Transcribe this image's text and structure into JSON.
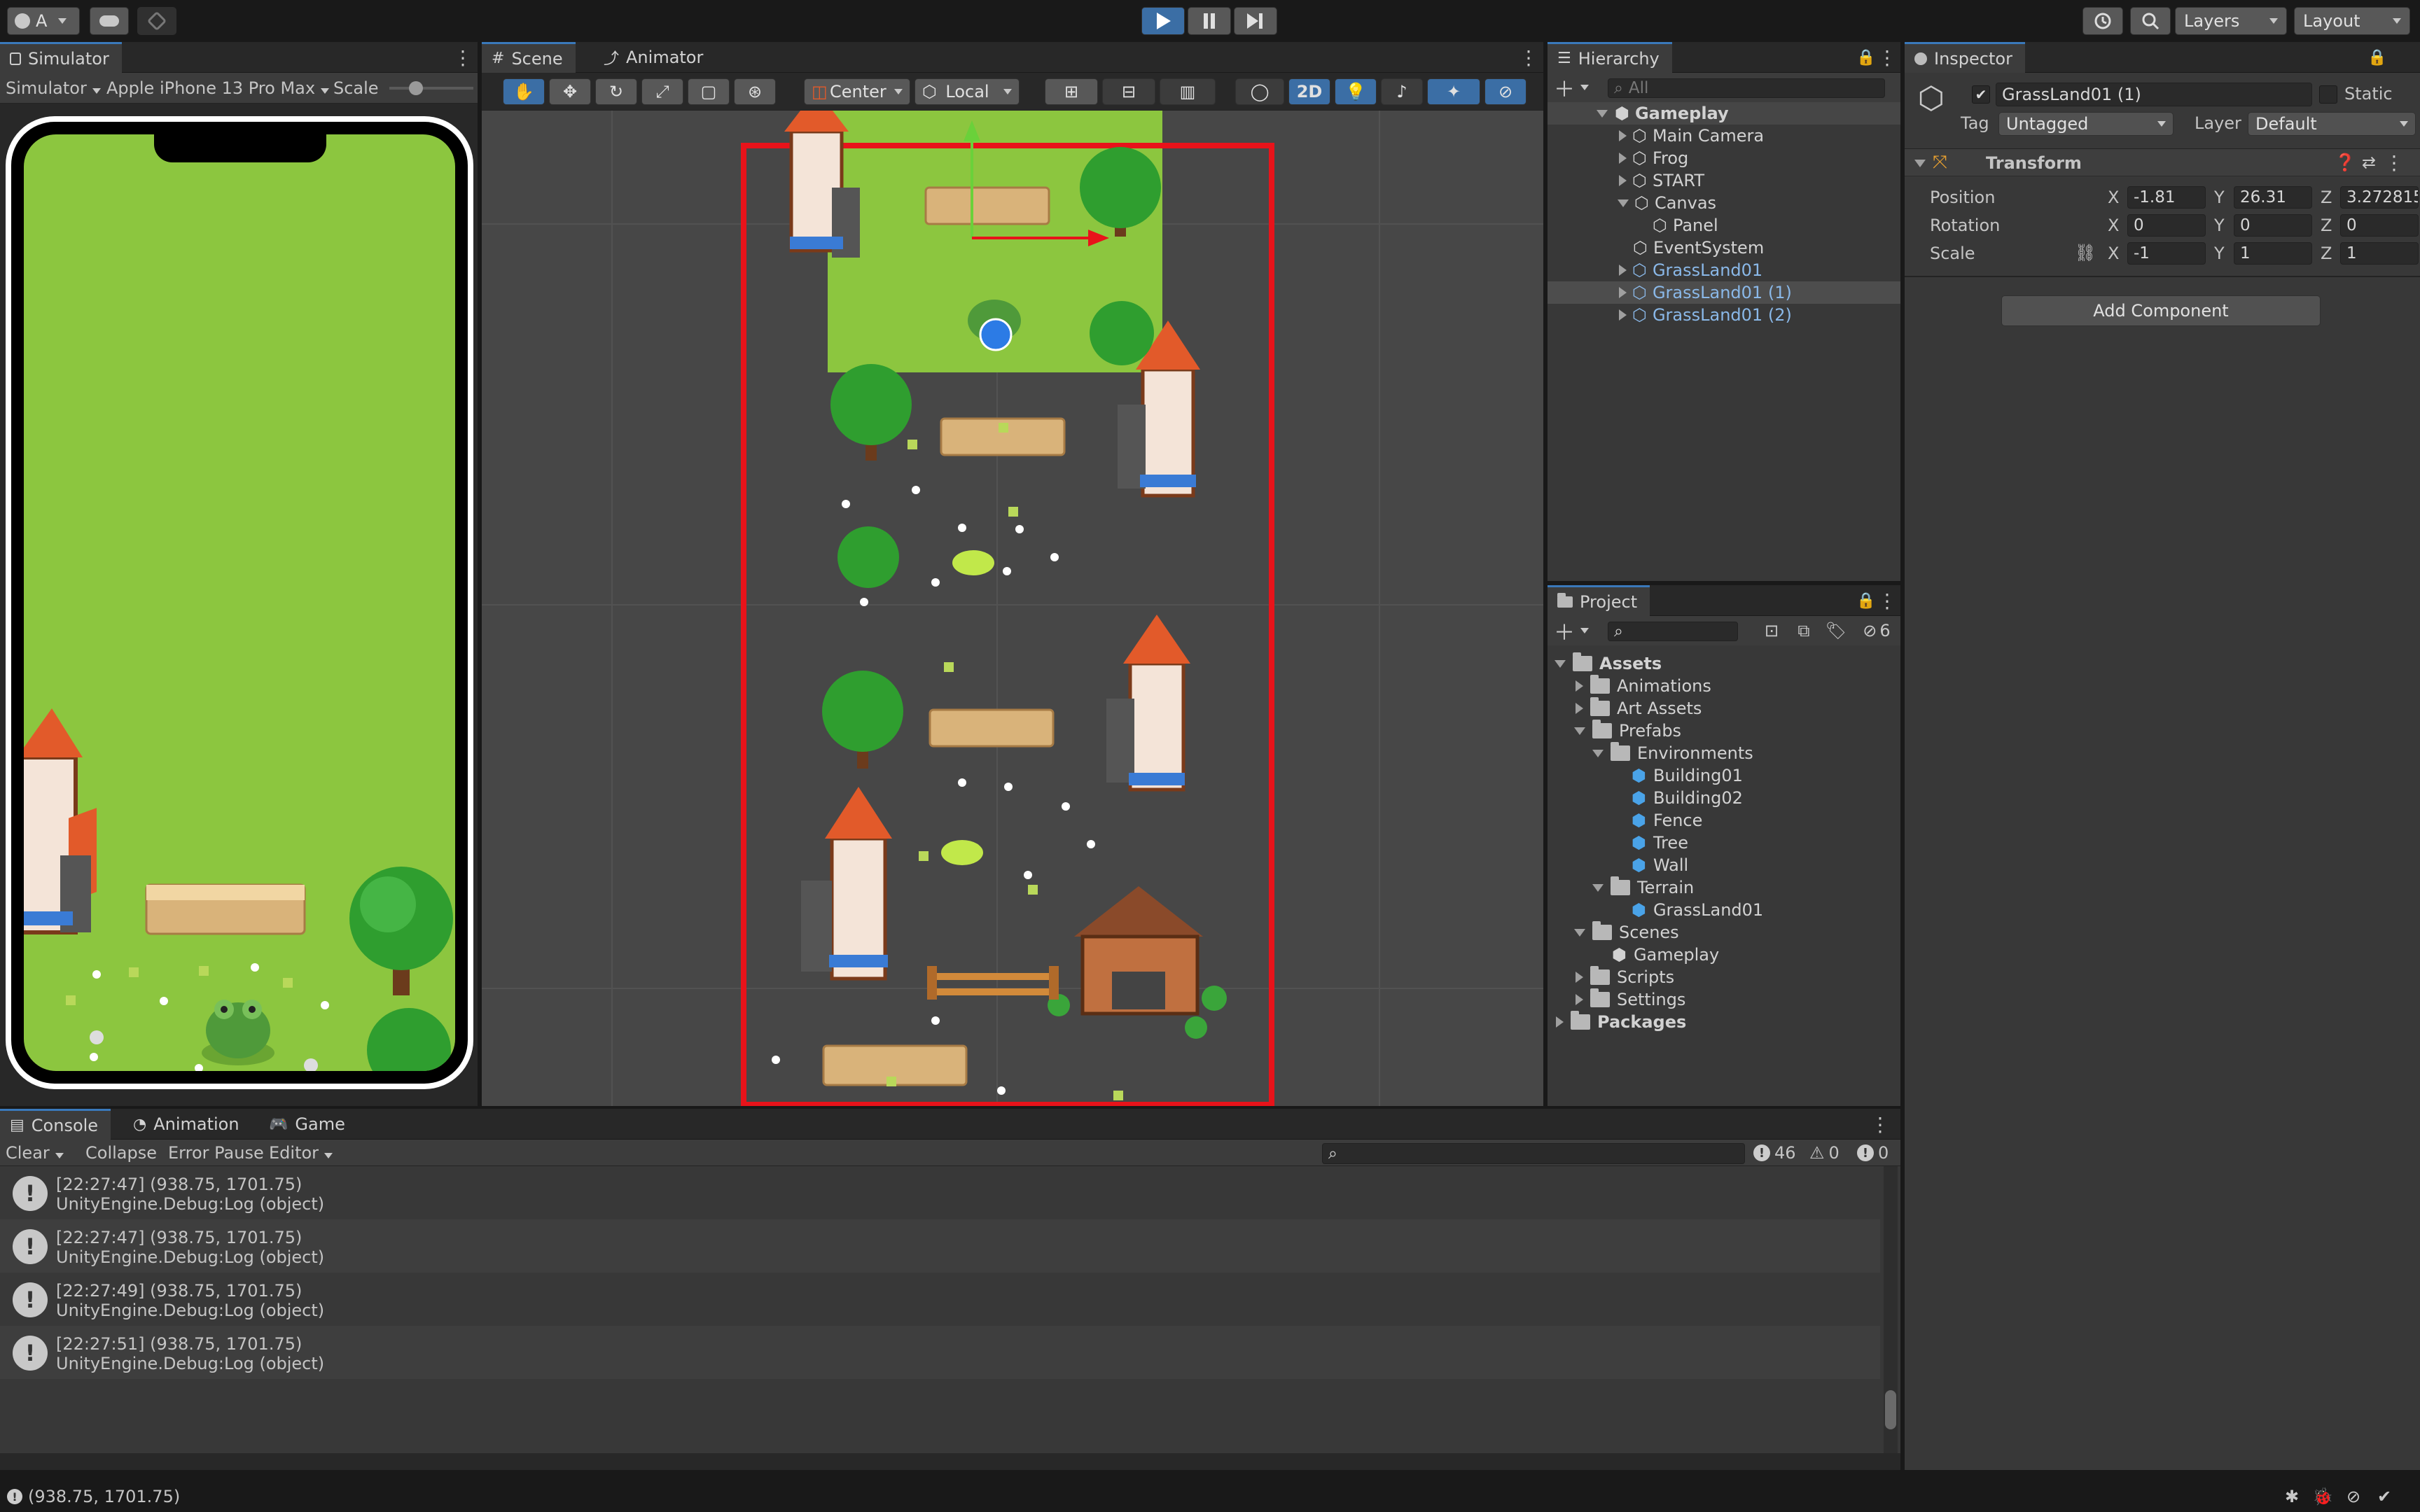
{
  "topbar": {
    "account_label": "A",
    "layers_label": "Layers",
    "layout_label": "Layout"
  },
  "simulator": {
    "tab_label": "Simulator",
    "mode_label": "Simulator",
    "device_label": "Apple iPhone 13 Pro Max",
    "scale_label": "Scale"
  },
  "scene": {
    "tabs": [
      "Scene",
      "Animator"
    ],
    "pivot_label": "Center",
    "space_label": "Local",
    "mode2d_label": "2D"
  },
  "hierarchy": {
    "tab_label": "Hierarchy",
    "search_placeholder": "All",
    "root": "Gameplay",
    "items": [
      {
        "label": "Main Camera",
        "expandable": true,
        "indent": 1
      },
      {
        "label": "Frog",
        "expandable": true,
        "indent": 1
      },
      {
        "label": "START",
        "expandable": true,
        "indent": 1
      },
      {
        "label": "Canvas",
        "expandable": true,
        "expanded": true,
        "indent": 1
      },
      {
        "label": "Panel",
        "expandable": false,
        "indent": 2
      },
      {
        "label": "EventSystem",
        "expandable": false,
        "indent": 1
      },
      {
        "label": "GrassLand01",
        "expandable": true,
        "indent": 1
      },
      {
        "label": "GrassLand01 (1)",
        "expandable": true,
        "indent": 1,
        "selected": true
      },
      {
        "label": "GrassLand01 (2)",
        "expandable": true,
        "indent": 1
      }
    ]
  },
  "project": {
    "tab_label": "Project",
    "hidden_count": "6",
    "tree": [
      {
        "label": "Assets",
        "type": "folder",
        "indent": 0,
        "expanded": true,
        "bold": true
      },
      {
        "label": "Animations",
        "type": "folder",
        "indent": 1
      },
      {
        "label": "Art Assets",
        "type": "folder",
        "indent": 1
      },
      {
        "label": "Prefabs",
        "type": "folder",
        "indent": 1,
        "expanded": true
      },
      {
        "label": "Environments",
        "type": "folder",
        "indent": 2,
        "expanded": true
      },
      {
        "label": "Building01",
        "type": "prefab",
        "indent": 3
      },
      {
        "label": "Building02",
        "type": "prefab",
        "indent": 3
      },
      {
        "label": "Fence",
        "type": "prefab",
        "indent": 3
      },
      {
        "label": "Tree",
        "type": "prefab",
        "indent": 3
      },
      {
        "label": "Wall",
        "type": "prefab",
        "indent": 3
      },
      {
        "label": "Terrain",
        "type": "folder",
        "indent": 2,
        "expanded": true
      },
      {
        "label": "GrassLand01",
        "type": "prefab",
        "indent": 3
      },
      {
        "label": "Scenes",
        "type": "folder",
        "indent": 1,
        "expanded": true
      },
      {
        "label": "Gameplay",
        "type": "scene",
        "indent": 2
      },
      {
        "label": "Scripts",
        "type": "folder",
        "indent": 1
      },
      {
        "label": "Settings",
        "type": "folder",
        "indent": 1
      },
      {
        "label": "Packages",
        "type": "folder",
        "indent": 0,
        "bold": true
      }
    ]
  },
  "inspector": {
    "tab_label": "Inspector",
    "object_name": "GrassLand01 (1)",
    "static_label": "Static",
    "tag_label": "Tag",
    "tag_value": "Untagged",
    "layer_label": "Layer",
    "layer_value": "Default",
    "transform_label": "Transform",
    "position_label": "Position",
    "rotation_label": "Rotation",
    "scale_label": "Scale",
    "position": {
      "x": "-1.81",
      "y": "26.31",
      "z": "3.272815"
    },
    "rotation": {
      "x": "0",
      "y": "0",
      "z": "0"
    },
    "scale": {
      "x": "-1",
      "y": "1",
      "z": "1"
    },
    "axis_x": "X",
    "axis_y": "Y",
    "axis_z": "Z",
    "add_component": "Add Component"
  },
  "console": {
    "tabs": [
      "Console",
      "Animation",
      "Game"
    ],
    "clear_label": "Clear",
    "collapse_label": "Collapse",
    "error_pause_label": "Error Pause",
    "editor_label": "Editor",
    "log_count": "46",
    "warn_count": "0",
    "error_count": "0",
    "entries": [
      {
        "line1": "[22:27:47] (938.75, 1701.75)",
        "line2": "UnityEngine.Debug:Log (object)"
      },
      {
        "line1": "[22:27:47] (938.75, 1701.75)",
        "line2": "UnityEngine.Debug:Log (object)"
      },
      {
        "line1": "[22:27:49] (938.75, 1701.75)",
        "line2": "UnityEngine.Debug:Log (object)"
      },
      {
        "line1": "[22:27:51] (938.75, 1701.75)",
        "line2": "UnityEngine.Debug:Log (object)"
      }
    ]
  },
  "statusbar": {
    "message": "(938.75, 1701.75)"
  },
  "colors": {
    "grass": "#8cc63f",
    "accent": "#3a79bb",
    "selection_red": "#e8131a"
  }
}
